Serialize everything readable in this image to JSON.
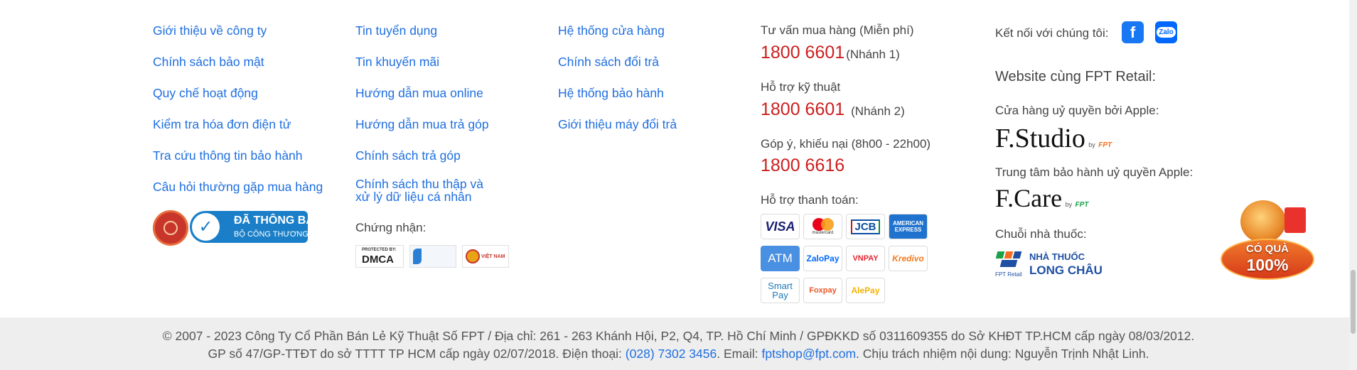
{
  "col1": {
    "links": [
      "Giới thiệu về công ty",
      "Chính sách bảo mật",
      "Quy chế hoạt động",
      "Kiểm tra hóa đơn điện tử",
      "Tra cứu thông tin bảo hành",
      "Câu hỏi thường gặp mua hàng"
    ],
    "badge_text": "ĐÃ THÔNG BÁO",
    "badge_sub": "BỘ CÔNG THƯƠNG"
  },
  "col2": {
    "links": [
      "Tin tuyển dụng",
      "Tin khuyến mãi",
      "Hướng dẫn mua online",
      "Hướng dẫn mua trả góp",
      "Chính sách trả góp"
    ],
    "wrap_link": "Chính sách thu thập và xử lý dữ liệu cá nhân",
    "cert_label": "Chứng nhận:",
    "cert_dmca": "DMCA",
    "cert_dmca_top": "PROTECTED BY:",
    "cert_vn": "VIỆT NAM"
  },
  "col3": {
    "links": [
      "Hệ thống cửa hàng",
      "Chính sách đổi trả",
      "Hệ thống bảo hành",
      "Giới thiệu máy đổi trả"
    ]
  },
  "col4": {
    "sales_label": "Tư vấn mua hàng (Miễn phí)",
    "sales_phone": "1800 6601",
    "sales_note": "(Nhánh 1)",
    "tech_label": "Hỗ trợ kỹ thuật",
    "tech_phone": "1800 6601",
    "tech_note": "(Nhánh 2)",
    "complaint_label": "Góp ý, khiếu nại (8h00 - 22h00)",
    "complaint_phone": "1800 6616",
    "payment_label": "Hỗ trợ thanh toán:",
    "payments": [
      "VISA",
      "mastercard",
      "JCB",
      "AMERICAN EXPRESS",
      "ATM",
      "ZaloPay",
      "VNPAY",
      "Kredivo",
      "Smart Pay",
      "Foxpay",
      "AlePay"
    ]
  },
  "col5": {
    "connect_label": "Kết nối với chúng tôi:",
    "zalo_label": "Zalo",
    "website_label": "Website cùng FPT Retail:",
    "apple_store_label": "Cửa hàng uỷ quyền bởi Apple:",
    "fstudio": "F.Studio",
    "by_fpt": "by",
    "fpt": "FPT",
    "apple_care_label": "Trung tâm bảo hành uỷ quyền Apple:",
    "fcare": "F.Care",
    "pharmacy_label": "Chuỗi nhà thuốc:",
    "pharmacy_line1": "NHÀ THUỐC",
    "pharmacy_line2": "LONG CHÂU",
    "fpt_retail": "FPT Retail"
  },
  "promo": {
    "line1": "CÓ QUÀ",
    "line2": "100%"
  },
  "footer": {
    "line1": "© 2007 - 2023 Công Ty Cổ Phần Bán Lẻ Kỹ Thuật Số FPT / Địa chỉ: 261 - 263 Khánh Hội, P2, Q4, TP. Hồ Chí Minh / GPĐKKD số 0311609355 do Sở KHĐT TP.HCM cấp ngày 08/03/2012.",
    "line2_a": "GP số 47/GP-TTĐT do sở TTTT TP HCM cấp ngày 02/07/2018. Điện thoại: ",
    "phone": "(028) 7302 3456",
    "line2_b": ". Email: ",
    "email": "fptshop@fpt.com",
    "line2_c": ". Chịu trách nhiệm nội dung: Nguyễn Trịnh Nhật Linh."
  },
  "colors": {
    "link": "#1f6fe0",
    "phone": "#cc1f1f",
    "footer_bg": "#eeeeee"
  }
}
